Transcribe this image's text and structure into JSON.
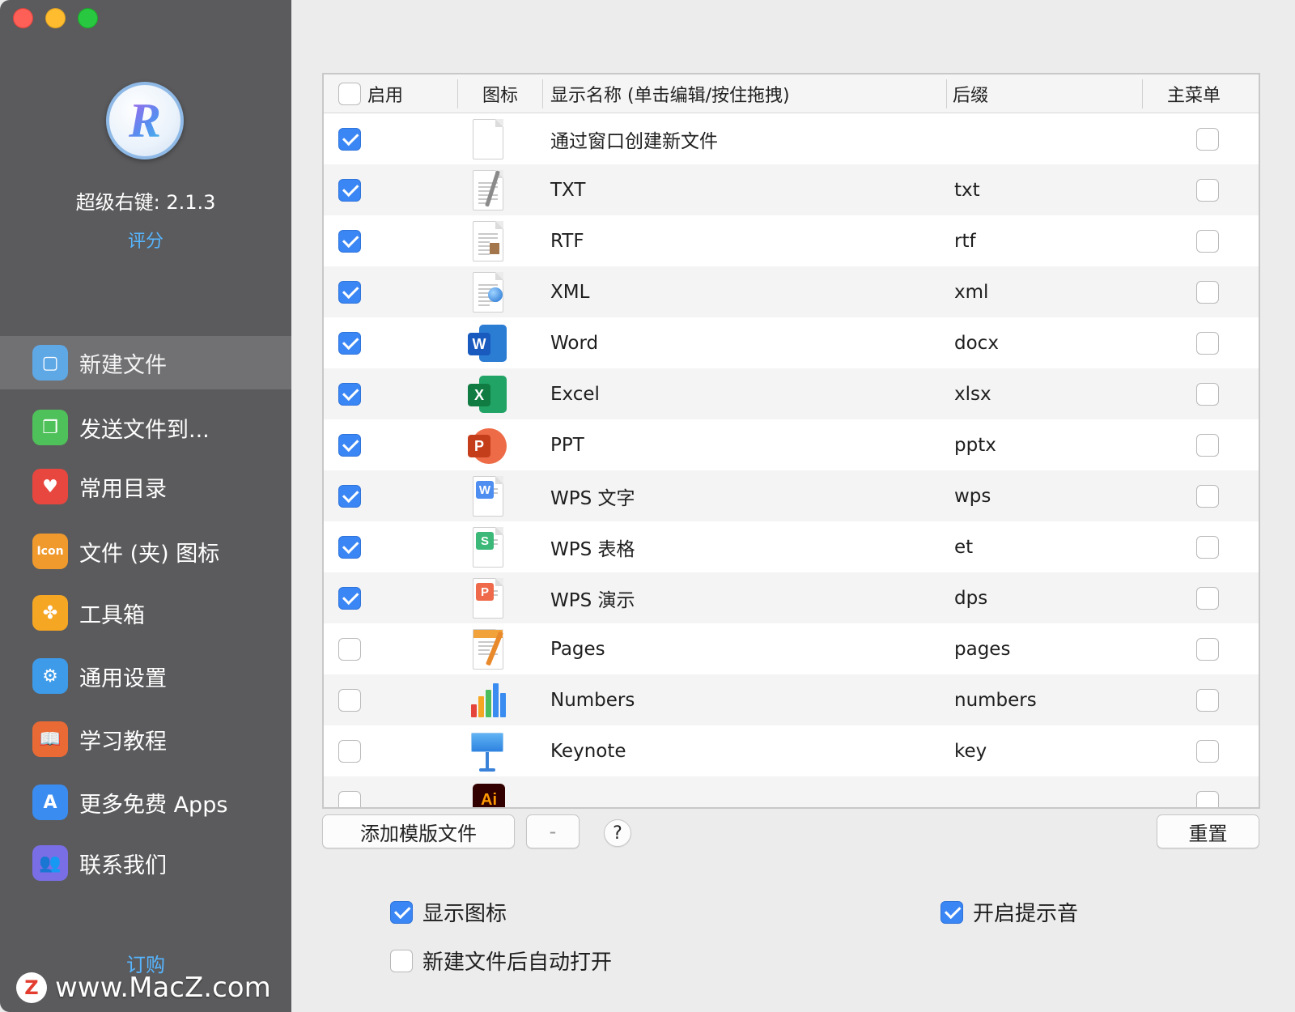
{
  "app": {
    "name_version": "超级右键: 2.1.3",
    "rate_label": "评分",
    "buy_label": "订购",
    "logo_letter": "R"
  },
  "watermark": {
    "badge": "Z",
    "text": "www.MacZ.com"
  },
  "sidebar": {
    "items": [
      {
        "label": "新建文件",
        "icon": "new-file-icon",
        "color": "#5fa8e6",
        "glyph": "▢",
        "active": true
      },
      {
        "label": "发送文件到...",
        "icon": "send-files-icon",
        "color": "#4fc15a",
        "glyph": "❐",
        "active": false
      },
      {
        "label": "常用目录",
        "icon": "heart-icon",
        "color": "#e8473f",
        "glyph": "♥",
        "active": false
      },
      {
        "label": "文件 (夹) 图标",
        "icon": "icon-badge-icon",
        "color": "#f09a2d",
        "glyph": "Icon",
        "active": false
      },
      {
        "label": "工具箱",
        "icon": "toolbox-icon",
        "color": "#f5a623",
        "glyph": "✤",
        "active": false
      },
      {
        "label": "通用设置",
        "icon": "gear-icon",
        "color": "#3d9be9",
        "glyph": "⚙",
        "active": false
      },
      {
        "label": "学习教程",
        "icon": "book-icon",
        "color": "#ea6a35",
        "glyph": "📖",
        "active": false
      },
      {
        "label": "更多免费 Apps",
        "icon": "app-store-icon",
        "color": "#3a8cf0",
        "glyph": "A",
        "active": false
      },
      {
        "label": "联系我们",
        "icon": "contacts-icon",
        "color": "#7a6ee6",
        "glyph": "👥",
        "active": false
      }
    ]
  },
  "table": {
    "headers": {
      "enabled": "启用",
      "icon": "图标",
      "display_name": "显示名称 (单击编辑/按住拖拽)",
      "suffix": "后缀",
      "main_menu": "主菜单"
    },
    "header_checkbox_checked": false,
    "rows": [
      {
        "enabled": true,
        "icon": "blank-document-icon",
        "name": "通过窗口创建新文件",
        "suffix": "",
        "main_menu": false
      },
      {
        "enabled": true,
        "icon": "txt-document-icon",
        "name": "TXT",
        "suffix": "txt",
        "main_menu": false
      },
      {
        "enabled": true,
        "icon": "rtf-document-icon",
        "name": "RTF",
        "suffix": "rtf",
        "main_menu": false
      },
      {
        "enabled": true,
        "icon": "xml-document-icon",
        "name": "XML",
        "suffix": "xml",
        "main_menu": false
      },
      {
        "enabled": true,
        "icon": "word-icon",
        "name": "Word",
        "suffix": "docx",
        "main_menu": false
      },
      {
        "enabled": true,
        "icon": "excel-icon",
        "name": "Excel",
        "suffix": "xlsx",
        "main_menu": false
      },
      {
        "enabled": true,
        "icon": "powerpoint-icon",
        "name": "PPT",
        "suffix": "pptx",
        "main_menu": false
      },
      {
        "enabled": true,
        "icon": "wps-writer-icon",
        "name": "WPS 文字",
        "suffix": "wps",
        "main_menu": false
      },
      {
        "enabled": true,
        "icon": "wps-spreadsheet-icon",
        "name": "WPS 表格",
        "suffix": "et",
        "main_menu": false
      },
      {
        "enabled": true,
        "icon": "wps-presentation-icon",
        "name": "WPS 演示",
        "suffix": "dps",
        "main_menu": false
      },
      {
        "enabled": false,
        "icon": "pages-icon",
        "name": "Pages",
        "suffix": "pages",
        "main_menu": false
      },
      {
        "enabled": false,
        "icon": "numbers-icon",
        "name": "Numbers",
        "suffix": "numbers",
        "main_menu": false
      },
      {
        "enabled": false,
        "icon": "keynote-icon",
        "name": "Keynote",
        "suffix": "key",
        "main_menu": false
      },
      {
        "enabled": false,
        "icon": "illustrator-icon",
        "name": "",
        "suffix": "",
        "main_menu": false
      }
    ]
  },
  "buttons": {
    "add_template": "添加模版文件",
    "remove": "-",
    "help": "?",
    "reset": "重置"
  },
  "options": {
    "show_icon": {
      "label": "显示图标",
      "checked": true
    },
    "sound": {
      "label": "开启提示音",
      "checked": true
    },
    "auto_open": {
      "label": "新建文件后自动打开",
      "checked": false
    }
  },
  "colors": {
    "sidebar_bg": "#5b5b5d",
    "sidebar_active": "#717174",
    "accent_blue": "#3a86f5",
    "link_blue": "#56b5ff"
  }
}
